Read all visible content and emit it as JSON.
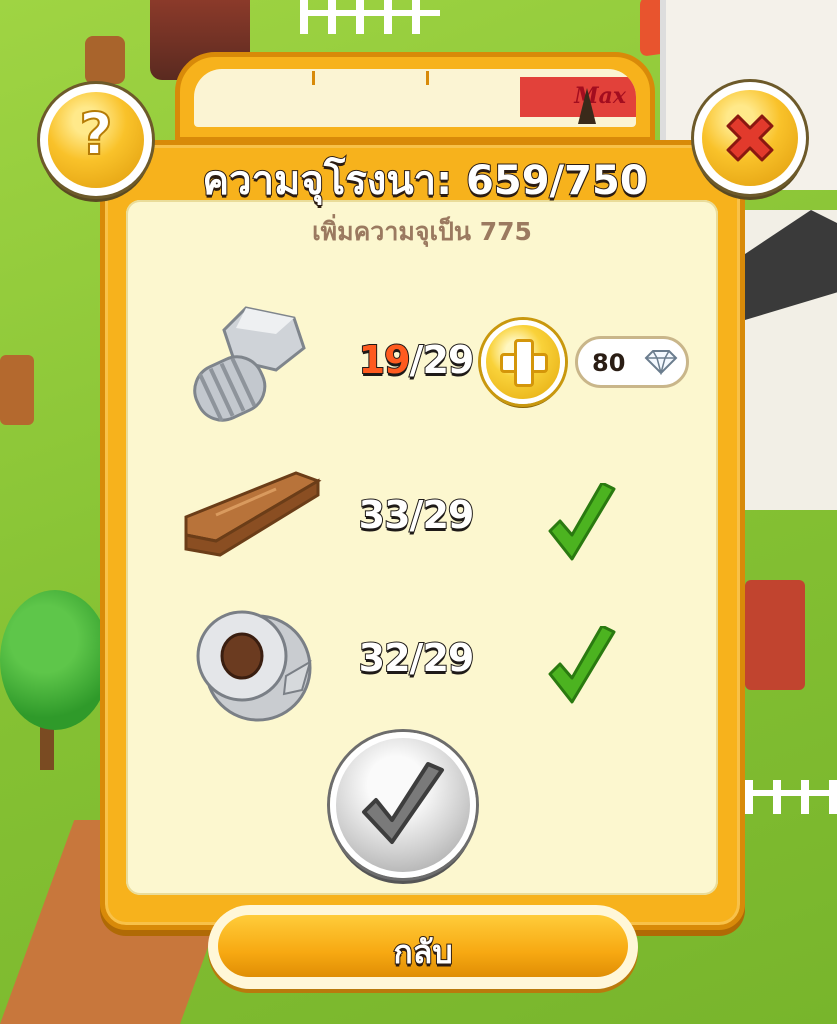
{
  "dialog": {
    "title": "ความจุโรงนา: 659/750",
    "subtitle": "เพิ่มความจุเป็น 775",
    "gauge_max_label": "Max",
    "help_glyph": "?",
    "back_label": "กลับ"
  },
  "items": [
    {
      "icon": "bolt-icon",
      "have": "19",
      "sep": "/",
      "need": "29",
      "sufficient": false
    },
    {
      "icon": "plank-icon",
      "have": "33",
      "sep": "/",
      "need": "29",
      "sufficient": true
    },
    {
      "icon": "duct-tape-icon",
      "have": "32",
      "sep": "/",
      "need": "29",
      "sufficient": true
    }
  ],
  "buy": {
    "cost": "80",
    "currency_icon": "diamond-icon"
  },
  "colors": {
    "accent": "#f7b21c",
    "panel": "#fcf7cf",
    "short": "#ff5b1f",
    "check": "#4cb320",
    "close": "#e23a2c"
  }
}
